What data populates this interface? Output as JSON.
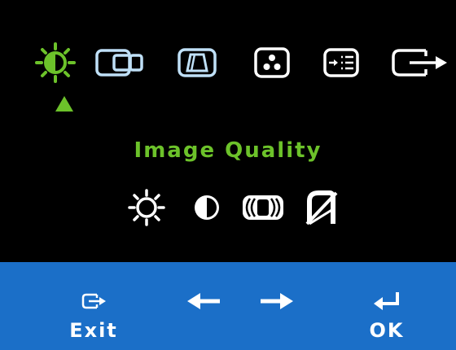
{
  "menu": {
    "title": "Image Quality",
    "top_icons": [
      "brightness-icon",
      "input-source-icon",
      "geometry-icon",
      "color-icon",
      "settings-icon",
      "exit-to-icon"
    ],
    "sub_icons": [
      "brightness-icon",
      "contrast-icon",
      "focus-icon",
      "sharpness-icon"
    ]
  },
  "footer": {
    "exit_label": "Exit",
    "ok_label": "OK"
  },
  "colors": {
    "accent": "#6cc22a",
    "icon": "#ffffff",
    "icon_outline": "#bfe0f7",
    "footer_bg": "#1b6fc8",
    "background": "#000000"
  }
}
